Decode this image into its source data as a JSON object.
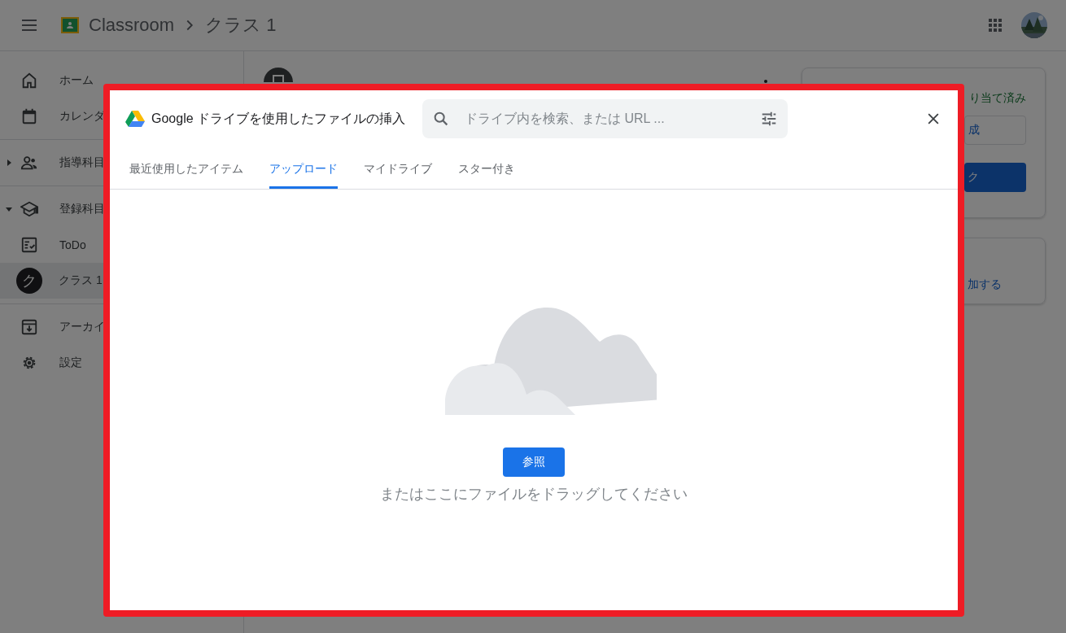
{
  "app_bar": {
    "title": "Classroom",
    "breadcrumb": "クラス 1"
  },
  "sidebar": {
    "top": [
      {
        "label": "ホーム",
        "kind": "home"
      },
      {
        "label": "カレンダ",
        "kind": "calendar"
      }
    ],
    "sections": [
      {
        "label": "指導科目",
        "kind": "teaching",
        "expanded": false
      },
      {
        "label": "登録科目",
        "kind": "enrolled",
        "expanded": true,
        "children": [
          {
            "label": "ToDo",
            "kind": "todo",
            "selected": false
          },
          {
            "label": "クラス 1",
            "kind": "class",
            "initial": "ク",
            "selected": true
          }
        ]
      }
    ],
    "bottom": [
      {
        "label": "アーカイ",
        "kind": "archive"
      },
      {
        "label": "設定",
        "kind": "settings"
      }
    ]
  },
  "side_card": {
    "status": "り当て済み",
    "create_button": "成",
    "submit_button": "ク"
  },
  "class_card": {
    "add_link": "加する"
  },
  "dialog": {
    "title": "Google ドライブを使用したファイルの挿入",
    "search": {
      "placeholder": "ドライブ内を検索、または URL ..."
    },
    "tabs": [
      {
        "label": "最近使用したアイテム",
        "selected": false
      },
      {
        "label": "アップロード",
        "selected": true
      },
      {
        "label": "マイドライブ",
        "selected": false
      },
      {
        "label": "スター付き",
        "selected": false
      }
    ],
    "browse_button": "参照",
    "drop_hint": "またはここにファイルをドラッグしてください"
  }
}
